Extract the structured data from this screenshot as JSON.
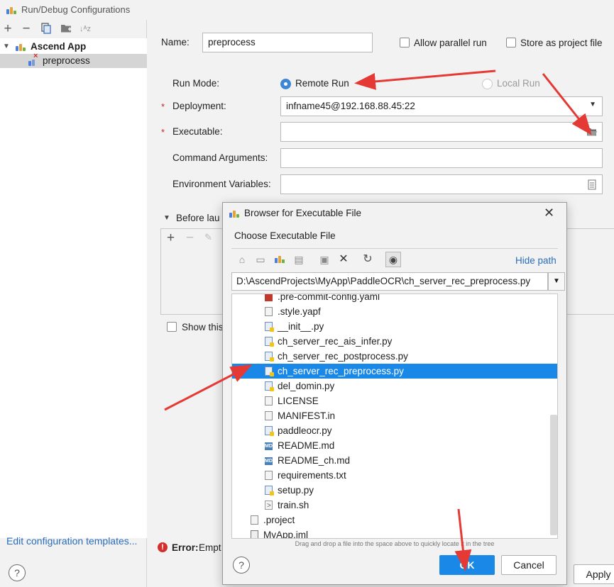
{
  "window": {
    "title": "Run/Debug Configurations"
  },
  "left_toolbar": [
    "add-icon",
    "remove-icon",
    "copy-icon",
    "folder-icon",
    "sort-icon"
  ],
  "tree": {
    "group": "Ascend App",
    "item": "preprocess"
  },
  "edit_templates": "Edit configuration templates...",
  "form": {
    "name_label": "Name:",
    "name_value": "preprocess",
    "allow_parallel": "Allow parallel run",
    "store_project": "Store as project file",
    "run_mode_label": "Run Mode:",
    "remote_run": "Remote Run",
    "local_run": "Local Run",
    "run_mode_selected": "Remote Run",
    "deployment_label": "Deployment:",
    "deployment_value": "infname45@192.168.88.45:22",
    "executable_label": "Executable:",
    "executable_value": "",
    "args_label": "Command Arguments:",
    "env_label": "Environment Variables:",
    "before_launch": "Before lau",
    "show_this": "Show this",
    "error_label": "Error:",
    "error_text": "Empt",
    "apply": "Apply"
  },
  "dialog": {
    "title": "Browser for Executable File",
    "subtitle": "Choose Executable File",
    "hide_path": "Hide path",
    "path": "D:\\AscendProjects\\MyApp\\PaddleOCR\\ch_server_rec_preprocess.py",
    "files": [
      {
        "name": ".pre-commit-config.yaml",
        "type": "yaml",
        "indent": 1,
        "partial": true
      },
      {
        "name": ".style.yapf",
        "type": "text",
        "indent": 1
      },
      {
        "name": "__init__.py",
        "type": "py",
        "indent": 1
      },
      {
        "name": "ch_server_rec_ais_infer.py",
        "type": "py",
        "indent": 1
      },
      {
        "name": "ch_server_rec_postprocess.py",
        "type": "py",
        "indent": 1
      },
      {
        "name": "ch_server_rec_preprocess.py",
        "type": "py",
        "indent": 1,
        "selected": true
      },
      {
        "name": "del_domin.py",
        "type": "py",
        "indent": 1
      },
      {
        "name": "LICENSE",
        "type": "text",
        "indent": 1
      },
      {
        "name": "MANIFEST.in",
        "type": "text",
        "indent": 1
      },
      {
        "name": "paddleocr.py",
        "type": "py",
        "indent": 1
      },
      {
        "name": "README.md",
        "type": "md",
        "indent": 1
      },
      {
        "name": "README_ch.md",
        "type": "md",
        "indent": 1
      },
      {
        "name": "requirements.txt",
        "type": "text",
        "indent": 1
      },
      {
        "name": "setup.py",
        "type": "py",
        "indent": 1
      },
      {
        "name": "train.sh",
        "type": "sh",
        "indent": 1
      },
      {
        "name": ".project",
        "type": "text",
        "indent": 0
      },
      {
        "name": "MyApp.iml",
        "type": "iml",
        "indent": 0
      }
    ],
    "hint": "Drag and drop a file into the space above to quickly locate it in the tree",
    "ok": "OK",
    "cancel": "Cancel"
  },
  "colors": {
    "accent": "#1a88e6",
    "selection": "#1a88e6",
    "error": "#c62828",
    "annotation_arrow": "#e53935"
  }
}
